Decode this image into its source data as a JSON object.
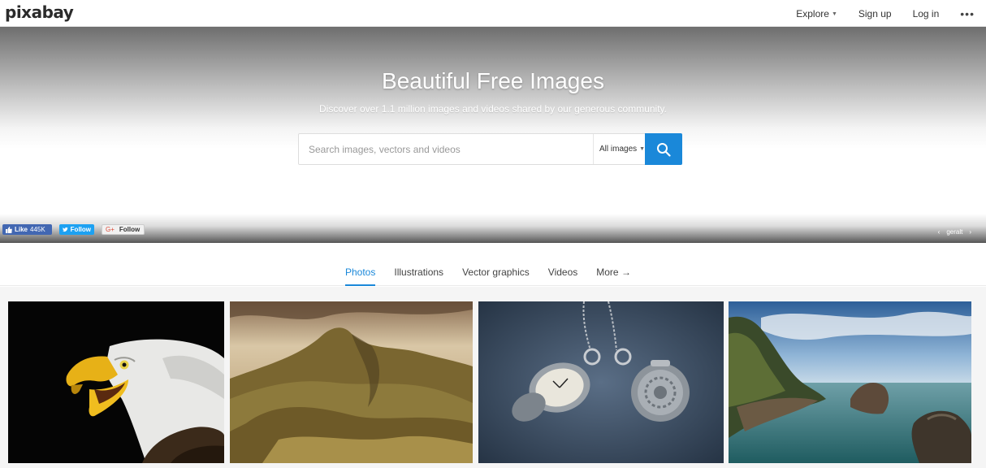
{
  "header": {
    "logo": "pixabay",
    "nav": {
      "explore": "Explore",
      "signup": "Sign up",
      "login": "Log in",
      "more": "•••"
    }
  },
  "hero": {
    "title": "Beautiful Free Images",
    "subtitle": "Discover over 1.1 million images and videos shared by our generous community.",
    "search": {
      "placeholder": "Search images, vectors and videos",
      "type_label": "All images"
    }
  },
  "social": {
    "facebook_label": "Like",
    "facebook_count": "445K",
    "twitter_label": "Follow",
    "google_label": "Follow"
  },
  "credit": {
    "prev": "‹",
    "user": "geralt",
    "next": "›"
  },
  "tabs": [
    {
      "label": "Photos",
      "active": true
    },
    {
      "label": "Illustrations"
    },
    {
      "label": "Vector graphics"
    },
    {
      "label": "Videos"
    },
    {
      "label": "More →"
    }
  ],
  "gallery": [
    {
      "subject": "bald eagle"
    },
    {
      "subject": "mountain landscape"
    },
    {
      "subject": "pocket watches"
    },
    {
      "subject": "sea cliffs"
    }
  ],
  "colors": {
    "accent": "#1a88d9",
    "facebook": "#4267b2",
    "twitter": "#1da1f2"
  }
}
